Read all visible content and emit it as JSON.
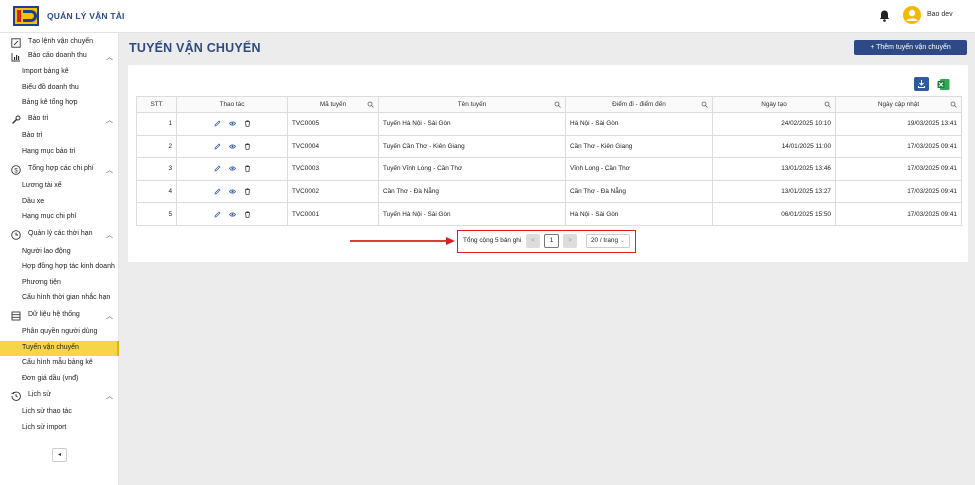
{
  "header": {
    "app_title": "QUẢN LÝ VẬN TẢI",
    "user_name": "Bao dev"
  },
  "sidebar": {
    "top_item": "Tạo lệnh vận chuyển",
    "groups": [
      {
        "label": "Báo cáo doanh thu",
        "icon": "chart-icon",
        "items": [
          "Import bảng kê",
          "Biểu đồ doanh thu",
          "Bảng kê tổng hợp"
        ]
      },
      {
        "label": "Bảo trì",
        "icon": "wrench-icon",
        "items": [
          "Bảo trì",
          "Hạng mục bảo trì"
        ]
      },
      {
        "label": "Tổng hợp các chi phí",
        "icon": "dollar-icon",
        "items": [
          "Lương tài xế",
          "Dầu xe",
          "Hạng mục chi phí"
        ]
      },
      {
        "label": "Quản lý các thời hạn",
        "icon": "clock-icon",
        "items": [
          "Người lao động",
          "Hợp đồng hợp tác kinh doanh",
          "Phương tiện",
          "Cấu hình thời gian nhắc hạn"
        ]
      },
      {
        "label": "Dữ liệu hệ thống",
        "icon": "database-icon",
        "items": [
          "Phân quyền người dùng",
          "Tuyến vận chuyển",
          "Cấu hình mẫu bảng kê",
          "Đơn giá dầu (vnđ)"
        ]
      },
      {
        "label": "Lịch sử",
        "icon": "history-icon",
        "items": [
          "Lịch sử thao tác",
          "Lịch sử import"
        ]
      }
    ],
    "active_item": "Tuyến vận chuyển",
    "collapse_label": "◂"
  },
  "main": {
    "page_title": "TUYẾN VẬN CHUYỂN",
    "add_button": "+  Thêm tuyến vận chuyển",
    "table": {
      "columns": [
        "STT",
        "Thao tác",
        "Mã tuyến",
        "Tên tuyến",
        "Điểm đi - điểm đến",
        "Ngày tạo",
        "Ngày cập nhật"
      ],
      "rows": [
        {
          "stt": "1",
          "code": "TVC0005",
          "name": "Tuyến Hà Nội - Sài Gòn",
          "route": "Hà Nội - Sài Gòn",
          "created": "24/02/2025 10:10",
          "updated": "19/03/2025 13:41"
        },
        {
          "stt": "2",
          "code": "TVC0004",
          "name": "Tuyến Cần Thơ - Kiên Giang",
          "route": "Cần Thơ - Kiên Giang",
          "created": "14/01/2025 11:00",
          "updated": "17/03/2025 09:41"
        },
        {
          "stt": "3",
          "code": "TVC0003",
          "name": "Tuyến Vĩnh Long - Cần Thơ",
          "route": "Vĩnh Long - Cần Thơ",
          "created": "13/01/2025 13:46",
          "updated": "17/03/2025 09:41"
        },
        {
          "stt": "4",
          "code": "TVC0002",
          "name": "Cần Thơ - Đà Nẵng",
          "route": "Cần Thơ - Đà Nẵng",
          "created": "13/01/2025 13:27",
          "updated": "17/03/2025 09:41"
        },
        {
          "stt": "5",
          "code": "TVC0001",
          "name": "Tuyến Hà Nội - Sài Gòn",
          "route": "Hà Nội - Sài Gòn",
          "created": "06/01/2025 15:50",
          "updated": "17/03/2025 09:41"
        }
      ]
    },
    "pagination": {
      "total_text": "Tổng cộng 5 bản ghi",
      "prev": "<",
      "current_page": "1",
      "next": ">",
      "page_size": "20 / trang"
    }
  },
  "colors": {
    "brand": "#2e4a86",
    "active_nav": "#f7d54a",
    "annotation": "#d62020"
  }
}
